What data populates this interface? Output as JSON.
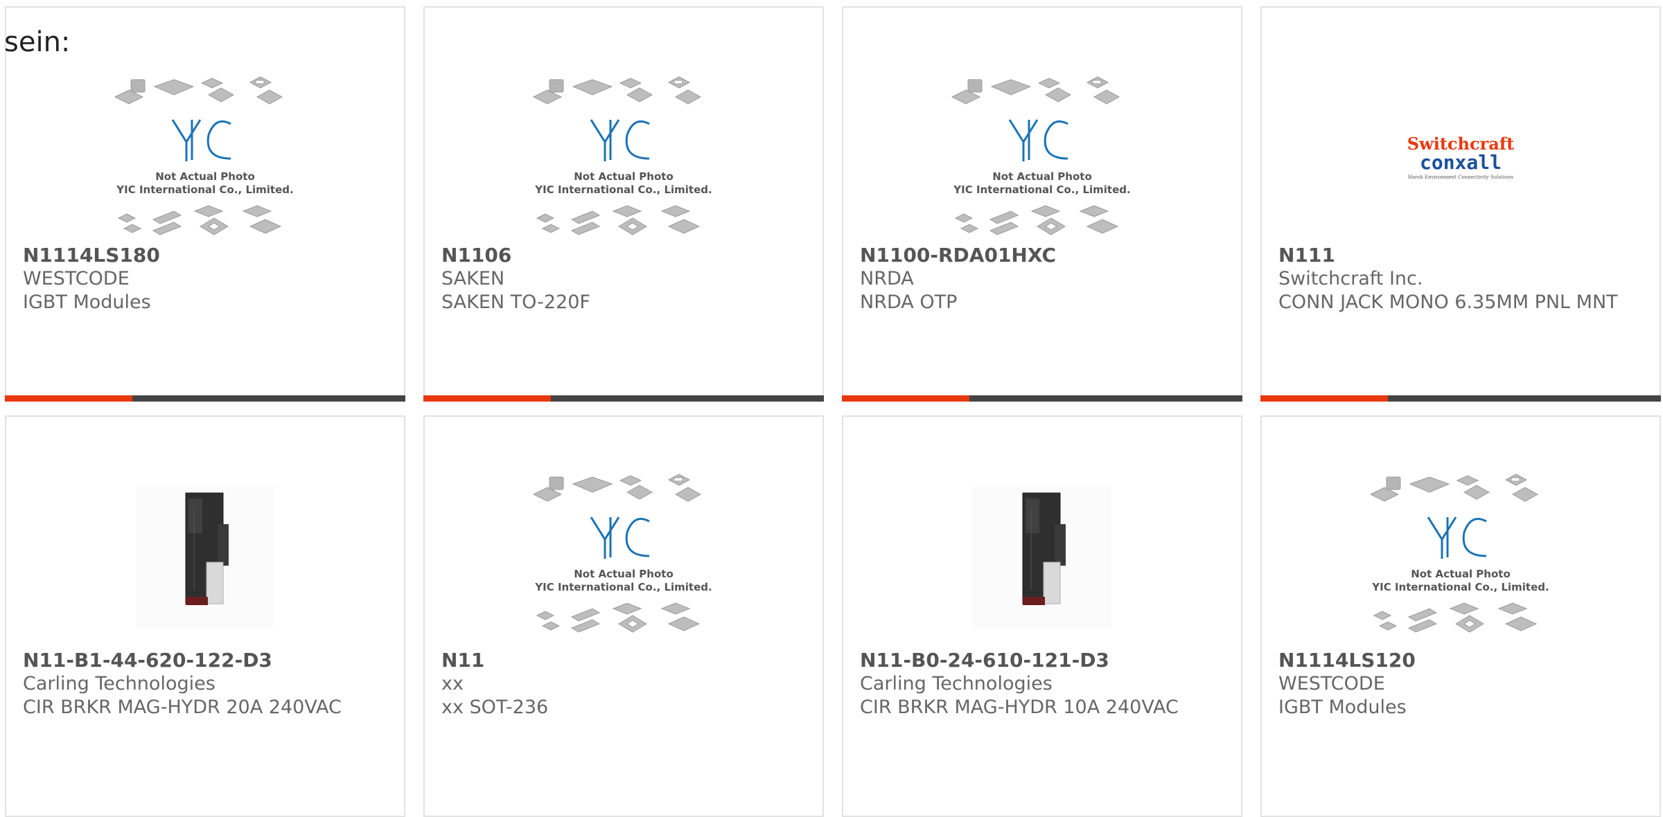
{
  "header": {
    "label": "sein:"
  },
  "colors": {
    "accent": "#e8380d",
    "bar": "#444444",
    "yic_blue": "#1a73b5"
  },
  "placeholder": {
    "line1": "Not Actual Photo",
    "line2": "YIC International Co., Limited."
  },
  "brand_logo": {
    "line1": "Switchcraft",
    "line2": "conxall",
    "line3": "Harsh Environment Connectivity Solutions"
  },
  "cards": [
    {
      "part": "N1114LS180",
      "maker": "WESTCODE",
      "desc": "IGBT Modules",
      "image": "placeholder"
    },
    {
      "part": "N1106",
      "maker": "SAKEN",
      "desc": "SAKEN TO-220F",
      "image": "placeholder"
    },
    {
      "part": "N1100-RDA01HXC",
      "maker": "NRDA",
      "desc": "NRDA OTP",
      "image": "placeholder"
    },
    {
      "part": "N111",
      "maker": "Switchcraft Inc.",
      "desc": "CONN JACK MONO 6.35MM PNL MNT",
      "image": "brand-logo"
    },
    {
      "part": "N11-B1-44-620-122-D3",
      "maker": "Carling Technologies",
      "desc": "CIR BRKR MAG-HYDR 20A 240VAC",
      "image": "breaker"
    },
    {
      "part": "N11",
      "maker": "xx",
      "desc": "xx SOT-236",
      "image": "placeholder"
    },
    {
      "part": "N11-B0-24-610-121-D3",
      "maker": "Carling Technologies",
      "desc": "CIR BRKR MAG-HYDR 10A 240VAC",
      "image": "breaker"
    },
    {
      "part": "N1114LS120",
      "maker": "WESTCODE",
      "desc": "IGBT Modules",
      "image": "placeholder"
    }
  ]
}
